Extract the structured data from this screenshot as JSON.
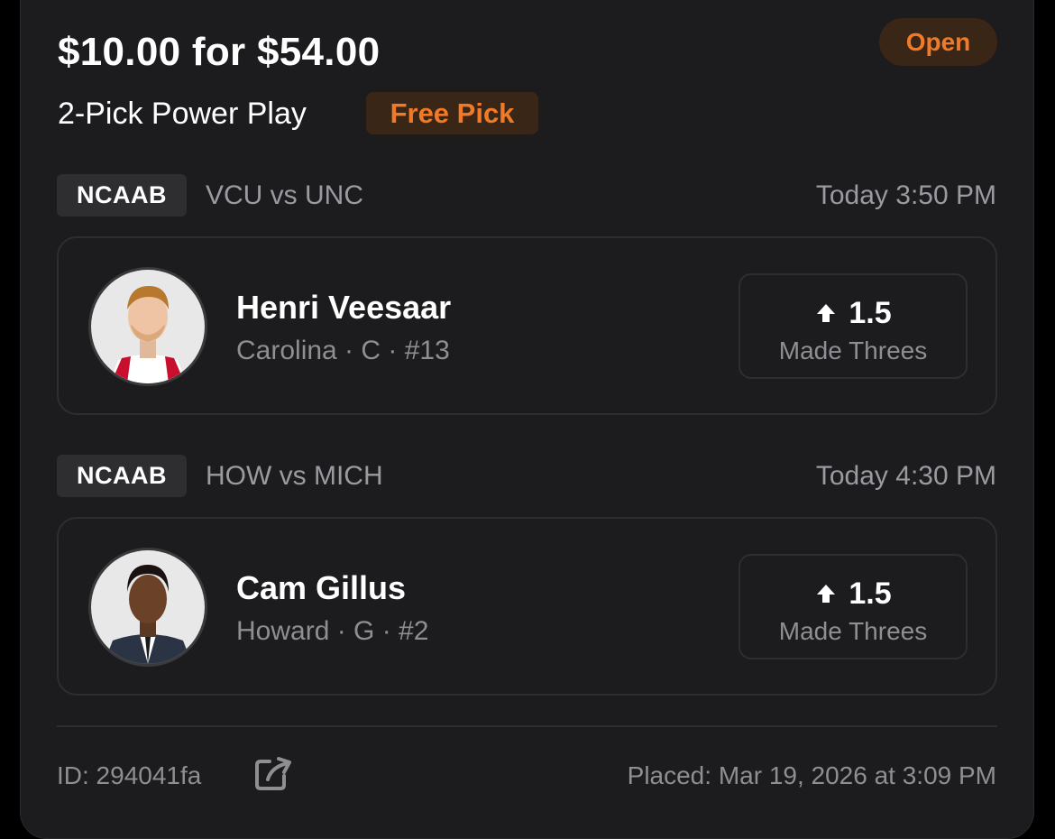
{
  "entry": {
    "title": "$10.00 for $54.00",
    "status": "Open",
    "play_type": "2-Pick Power Play",
    "promo_badge": "Free Pick"
  },
  "picks": [
    {
      "league": "NCAAB",
      "matchup": "VCU vs UNC",
      "time": "Today 3:50 PM",
      "player_name": "Henri Veesaar",
      "player_meta": "Carolina · C · #13",
      "direction_icon": "arrow-up-icon",
      "line": "1.5",
      "stat": "Made Threes"
    },
    {
      "league": "NCAAB",
      "matchup": "HOW vs MICH",
      "time": "Today 4:30 PM",
      "player_name": "Cam Gillus",
      "player_meta": "Howard · G · #2",
      "direction_icon": "arrow-up-icon",
      "line": "1.5",
      "stat": "Made Threes"
    }
  ],
  "footer": {
    "id_text": "ID: 294041fa",
    "share_icon": "external-link-icon",
    "placed_text": "Placed: Mar 19, 2026 at 3:09 PM"
  },
  "colors": {
    "accent_orange": "#f07a28",
    "card_bg": "#1c1c1e",
    "muted_text": "#8e8e93"
  }
}
